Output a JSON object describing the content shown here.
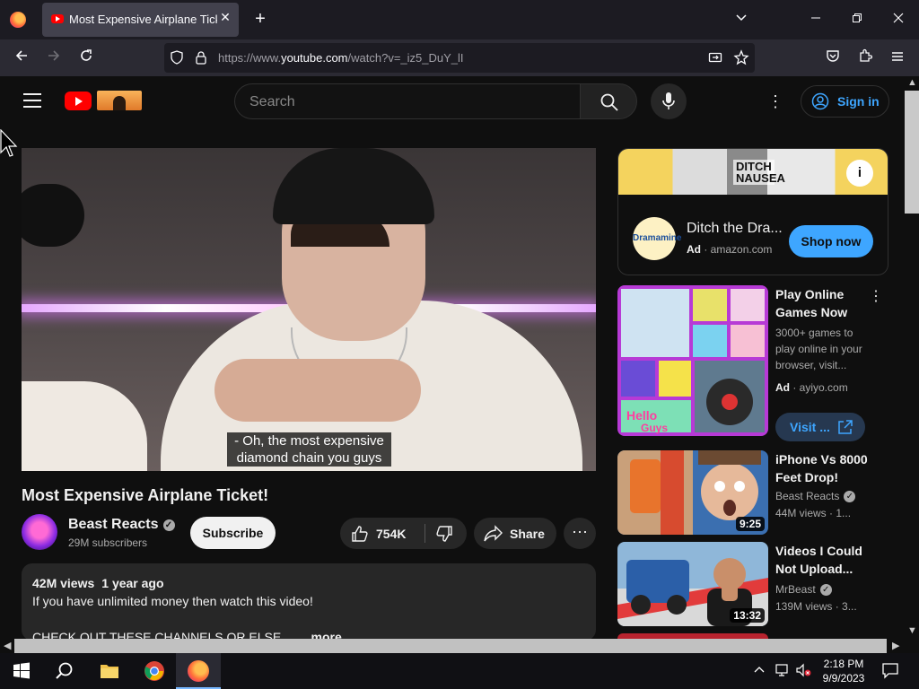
{
  "browser": {
    "tab_title": "Most Expensive Airplane Ticket!",
    "tab_close": "✕",
    "new_tab": "+",
    "url_prefix": "https://www.",
    "url_domain": "youtube.com",
    "url_path": "/watch?v=_iz5_DuY_lI"
  },
  "youtube": {
    "search_placeholder": "Search",
    "sign_in": "Sign in"
  },
  "video": {
    "caption_line1": "- Oh, the most expensive",
    "caption_line2": "diamond chain you guys",
    "title": "Most Expensive Airplane Ticket!",
    "channel_name": "Beast Reacts",
    "subscribers": "29M subscribers",
    "subscribe_label": "Subscribe",
    "like_count": "754K",
    "share_label": "Share",
    "views": "42M views",
    "age": "1 year ago",
    "description_line1": "If you have unlimited money then watch this video!",
    "description_line2": "CHECK OUT THESE CHANNELS OR ELSE...",
    "more_label": "...more"
  },
  "sidebar": {
    "ad": {
      "banner_text": "DITCH NAUSEA",
      "logo_text": "Dramamine",
      "title": "Ditch the Dra...",
      "ad_label": "Ad",
      "domain": "amazon.com",
      "cta": "Shop now"
    },
    "games_ad": {
      "title": "Play Online Games Now",
      "description": "3000+ games to play online in your browser, visit...",
      "ad_label": "Ad",
      "domain": "ayiyo.com",
      "cta": "Visit ..."
    },
    "videos": [
      {
        "title": "iPhone Vs 8000 Feet Drop!",
        "channel": "Beast Reacts",
        "views": "44M views",
        "age": "1...",
        "duration": "9:25"
      },
      {
        "title": "Videos I Could Not Upload...",
        "channel": "MrBeast",
        "views": "139M views",
        "age": "3...",
        "duration": "13:32"
      }
    ]
  },
  "taskbar": {
    "time": "2:18 PM",
    "date": "9/9/2023"
  }
}
